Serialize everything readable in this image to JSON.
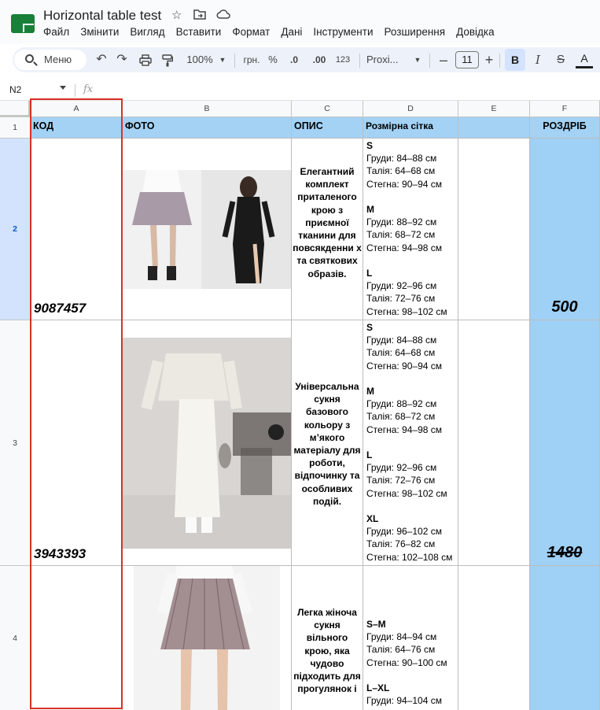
{
  "doc": {
    "title": "Horizontal table test",
    "menu": [
      "Файл",
      "Змінити",
      "Вигляд",
      "Вставити",
      "Формат",
      "Дані",
      "Інструменти",
      "Розширення",
      "Довідка"
    ]
  },
  "toolbar": {
    "search_label": "Меню",
    "zoom": "100%",
    "currency": "грн.",
    "percent": "%",
    "dec_decrease": ".0",
    "dec_increase": ".00",
    "number_format": "123",
    "font": "Proxi...",
    "font_size": "11",
    "bold": "B",
    "italic": "I",
    "strike": "S",
    "text_color": "A"
  },
  "formula_bar": {
    "name_box": "N2",
    "fx": "fx"
  },
  "columns": [
    "A",
    "B",
    "C",
    "D",
    "E",
    "F"
  ],
  "rows": [
    "1",
    "2",
    "3",
    "4"
  ],
  "header_row": {
    "a": "КОД",
    "b": "ФОТО",
    "c": "ОПИС",
    "d": "Розмірна сітка",
    "e": "",
    "f": "РОЗДРІБ"
  },
  "products": [
    {
      "code": "9087457",
      "description": "Елегантний комплект приталеного крою з приємної тканини для повсякденни х та святкових образів.",
      "sizes": [
        {
          "size": "S",
          "lines": [
            "Груди: 84–88 см",
            "Талія: 64–68 см",
            "Стегна: 90–94 см"
          ]
        },
        {
          "size": "M",
          "lines": [
            "Груди: 88–92 см",
            "Талія: 68–72 см",
            "Стегна: 94–98 см"
          ]
        },
        {
          "size": "L",
          "lines": [
            "Груди: 92–96 см",
            "Талія: 72–76 см",
            "Стегна: 98–102 см"
          ]
        }
      ],
      "price": "500",
      "price_strike": false
    },
    {
      "code": "3943393",
      "description": "Універсальна сукня базового кольору з м’якого матеріалу для роботи, відпочинку та особливих подій.",
      "sizes": [
        {
          "size": "S",
          "lines": [
            "Груди: 84–88 см",
            "Талія: 64–68 см",
            "Стегна: 90–94 см"
          ]
        },
        {
          "size": "M",
          "lines": [
            "Груди: 88–92 см",
            "Талія: 68–72 см",
            "Стегна: 94–98 см"
          ]
        },
        {
          "size": "L",
          "lines": [
            "Груди: 92–96 см",
            "Талія: 72–76 см",
            "Стегна: 98–102 см"
          ]
        },
        {
          "size": "XL",
          "lines": [
            "Груди: 96–102 см",
            "Талія: 76–82 см",
            "Стегна: 102–108 см"
          ]
        }
      ],
      "price": "1480",
      "price_strike": true
    },
    {
      "code": "",
      "description": "Легка жіноча сукня вільного крою, яка чудово підходить для прогулянок і",
      "sizes": [
        {
          "size": "S–M",
          "lines": [
            "Груди: 84–94 см",
            "Талія: 64–76 см",
            "Стегна: 90–100 см"
          ]
        },
        {
          "size": "L–XL",
          "lines": [
            "Груди: 94–104 см"
          ]
        }
      ],
      "price": "",
      "price_strike": false
    }
  ],
  "colors": {
    "header_blue": "#a3d2f5",
    "price_blue": "#9fd0f5",
    "selection": "#d3e3fd",
    "frame_red": "#d93025"
  }
}
